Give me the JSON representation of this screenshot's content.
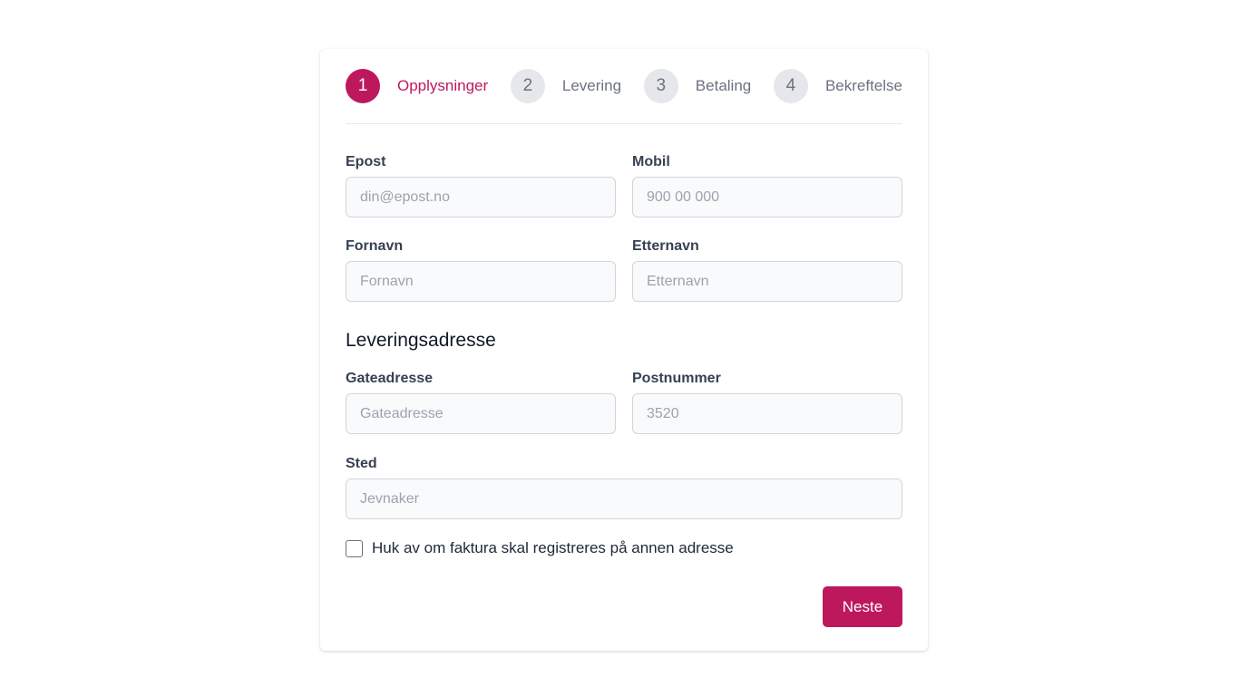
{
  "stepper": {
    "steps": [
      {
        "number": "1",
        "label": "Opplysninger"
      },
      {
        "number": "2",
        "label": "Levering"
      },
      {
        "number": "3",
        "label": "Betaling"
      },
      {
        "number": "4",
        "label": "Bekreftelse"
      }
    ],
    "active_step": 1
  },
  "form": {
    "email": {
      "label": "Epost",
      "placeholder": "din@epost.no",
      "value": ""
    },
    "mobile": {
      "label": "Mobil",
      "placeholder": "900 00 000",
      "value": ""
    },
    "first_name": {
      "label": "Fornavn",
      "placeholder": "Fornavn",
      "value": ""
    },
    "last_name": {
      "label": "Etternavn",
      "placeholder": "Etternavn",
      "value": ""
    },
    "address_section_title": "Leveringsadresse",
    "street": {
      "label": "Gateadresse",
      "placeholder": "Gateadresse",
      "value": ""
    },
    "postal_code": {
      "label": "Postnummer",
      "placeholder": "3520",
      "value": ""
    },
    "city": {
      "label": "Sted",
      "placeholder": "Jevnaker",
      "value": ""
    },
    "invoice_checkbox": {
      "label": "Huk av om faktura skal registreres på annen adresse",
      "checked": false
    },
    "next_button": "Neste"
  },
  "colors": {
    "accent": "#be185d",
    "inactive_step_bg": "#e5e7eb",
    "inactive_step_text": "#6b7280"
  }
}
